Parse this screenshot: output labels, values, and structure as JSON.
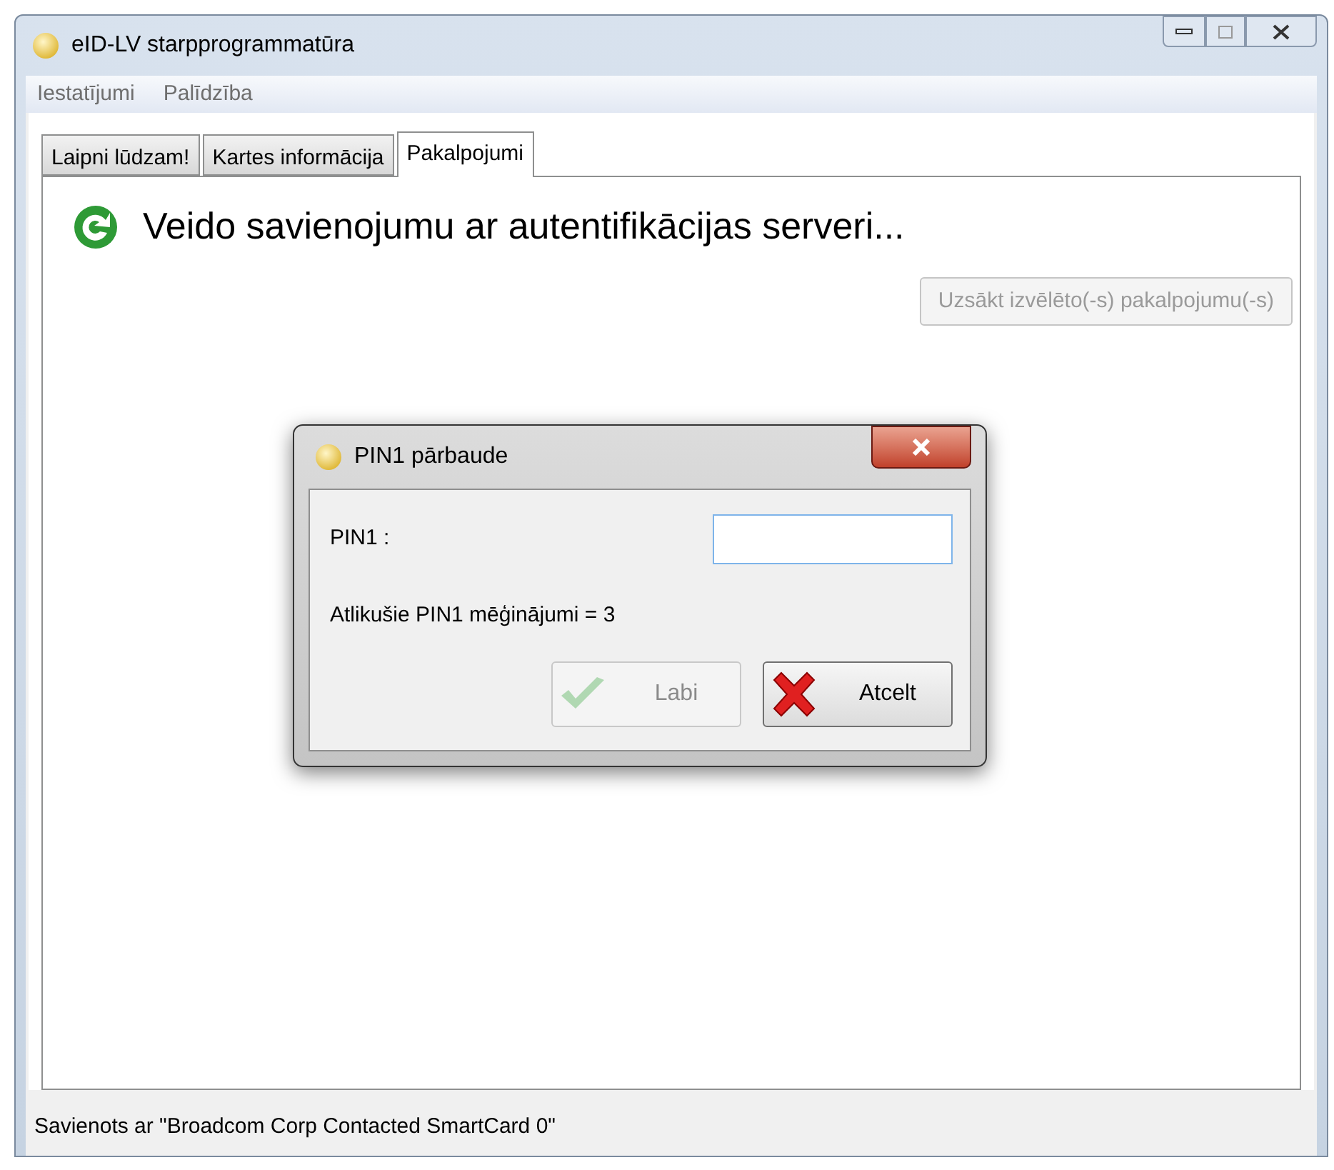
{
  "window": {
    "title": "eID-LV starpprogrammatūra"
  },
  "menu": [
    {
      "label": "Iestatījumi"
    },
    {
      "label": "Palīdzība"
    }
  ],
  "tabs": [
    {
      "label": "Laipni lūdzam!",
      "selected": false
    },
    {
      "label": "Kartes informācija",
      "selected": false
    },
    {
      "label": "Pakalpojumi",
      "selected": true
    }
  ],
  "status_message": "Veido savienojumu ar autentifikācijas serveri...",
  "start_button": {
    "label": "Uzsākt izvēlēto(-s) pakalpojumu(-s)",
    "disabled": true
  },
  "dialog": {
    "title": "PIN1 pārbaude",
    "field_label": "PIN1 :",
    "remaining": "Atlikušie PIN1 mēģinājumi = 3",
    "buttons": [
      {
        "kind": "ok",
        "label": "Labi",
        "disabled": true
      },
      {
        "kind": "cancel",
        "label": "Atcelt",
        "disabled": false
      }
    ]
  },
  "status_bar": "Savienots ar \"Broadcom Corp Contacted SmartCard 0\""
}
